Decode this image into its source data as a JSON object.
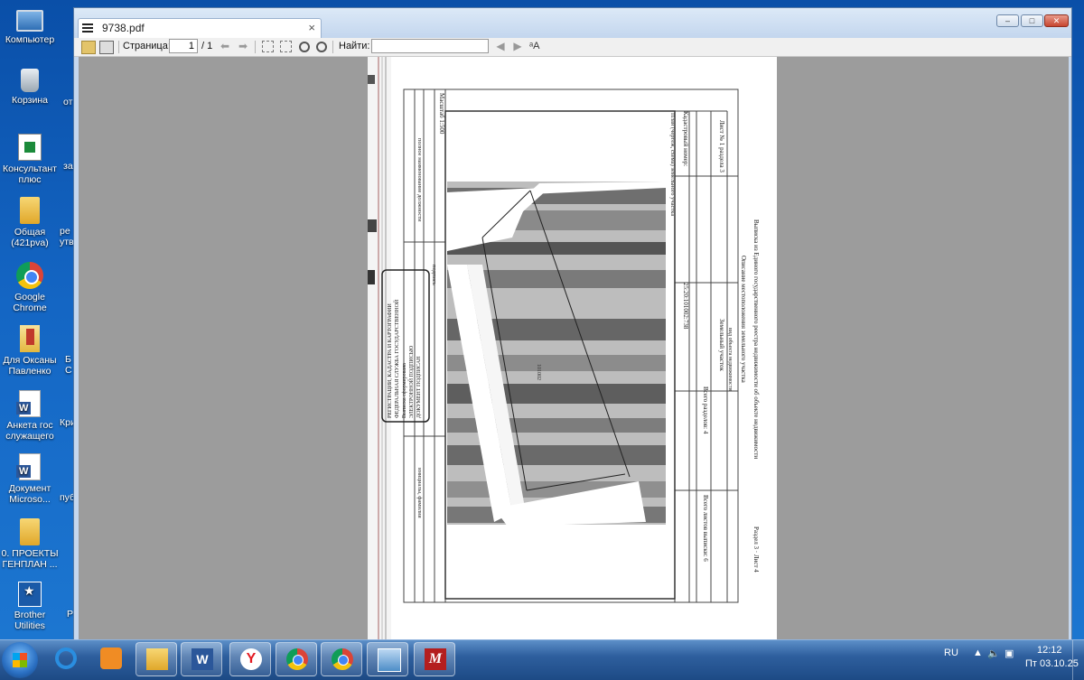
{
  "desktop": {
    "icons": [
      {
        "label": "Компьютер"
      },
      {
        "label": "Корзина"
      },
      {
        "label": "Консультант плюс"
      },
      {
        "label": "Общая (421pva)"
      },
      {
        "label": "Google Chrome"
      },
      {
        "label": "Для Оксаны Павленко"
      },
      {
        "label": "Анкета гос служащего"
      },
      {
        "label": "Документ Microso..."
      },
      {
        "label": "0. ПРОЕКТЫ ГЕНПЛАН ..."
      },
      {
        "label": "Brother Utilities"
      }
    ],
    "partial_labels": [
      "от",
      "за",
      "ре утв",
      "Б С",
      "Кри",
      "пуб",
      "Р"
    ]
  },
  "window": {
    "tab_title": "9738.pdf",
    "tab_close": "×",
    "buttons": {
      "minimize": "–",
      "maximize": "□",
      "close": "✕"
    }
  },
  "toolbar": {
    "page_label": "Страница:",
    "page_value": "1",
    "page_total": "/ 1",
    "find_label": "Найти:",
    "find_value": ""
  },
  "document": {
    "texts": {
      "title": "Выписка из Единого государственного реестра недвижимости об объекте недвижимости",
      "section": "Описание местоположения земельного участка",
      "sheet": "Лист № 1 раздела 3",
      "total_sections": "Всего разделов: 4",
      "total_sheets": "Всего листов выписки: 6",
      "cadastral": "25:20:101002:738",
      "object": "Земельный участок",
      "object_type": "вид объекта недвижимости",
      "plan_label": "План (чертеж, схема) земельного участка",
      "cad_num_label": "Кадастровый номер:",
      "scale": "Масштаб 1:500",
      "position": "полное наименование должности",
      "signature": "подпись",
      "initials": "инициалы, фамилия",
      "footer": "Раздел 3 · Лист 4",
      "parcel_label": "101002",
      "stamp_line1": "ДОКУМЕНТ ПОДПИСАН",
      "stamp_line2": "ЭЛЕКТРОННОЙ ПОДПИСЬЮ",
      "stamp_line3": "Выписка сформирована",
      "stamp_line4": "ФЕДЕРАЛЬНАЯ СЛУЖБА ГОСУДАРСТВЕННОЙ",
      "stamp_line5": "РЕГИСТРАЦИИ, КАДАСТРА И КАРТОГРАФИИ"
    }
  },
  "taskbar": {
    "apps": [
      {
        "name": "internet-explorer"
      },
      {
        "name": "media-player"
      },
      {
        "name": "explorer"
      },
      {
        "name": "word",
        "glyph": "W"
      },
      {
        "name": "yandex",
        "glyph": "Y"
      },
      {
        "name": "chrome"
      },
      {
        "name": "chrome"
      },
      {
        "name": "image-viewer"
      },
      {
        "name": "pdf-master",
        "glyph": "M"
      }
    ],
    "lang": "RU",
    "time": "12:12",
    "date": "Пт 03.10.25"
  }
}
